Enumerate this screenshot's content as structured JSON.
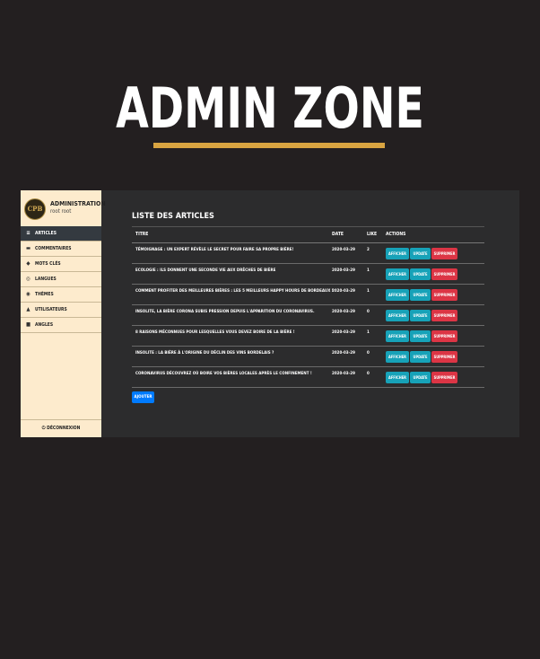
{
  "page": {
    "title": "ADMIN ZONE"
  },
  "brand": {
    "logo_text": "CPB",
    "title": "ADMINISTRATION",
    "subtitle": "root root"
  },
  "menu": [
    {
      "label": "ARTICLES",
      "icon": "list-icon",
      "glyph": "≡",
      "active": true
    },
    {
      "label": "COMMENTAIRES",
      "icon": "comment-icon",
      "glyph": "▬",
      "active": false
    },
    {
      "label": "MOTS CLÉS",
      "icon": "tag-icon",
      "glyph": "◆",
      "active": false
    },
    {
      "label": "LANGUES",
      "icon": "globe-icon",
      "glyph": "◎",
      "active": false
    },
    {
      "label": "THÈMES",
      "icon": "theme-icon",
      "glyph": "◉",
      "active": false
    },
    {
      "label": "UTILISATEURS",
      "icon": "user-icon",
      "glyph": "▲",
      "active": false
    },
    {
      "label": "ANGLES",
      "icon": "folder-icon",
      "glyph": "■",
      "active": false
    }
  ],
  "logout": {
    "label": "DÉCONNEXION"
  },
  "content": {
    "list_title": "LISTE DES ARTICLES",
    "columns": {
      "title": "TITRE",
      "date": "DATE",
      "like": "LIKE",
      "actions": "ACTIONS"
    },
    "buttons": {
      "show": "AFFICHER",
      "update": "UPDATE",
      "delete": "SUPPRIMER"
    },
    "rows": [
      {
        "title": "TÉMOIGNAGE : UN EXPERT RÉVÈLE LE SECRET POUR FAIRE SA PROPRE BIÈRE!",
        "date": "2020-03-29",
        "like": "2"
      },
      {
        "title": "ECOLOGIE : ILS DONNENT UNE SECONDE VIE AUX DRÊCHES DE BIÈRE",
        "date": "2020-03-29",
        "like": "1"
      },
      {
        "title": "COMMENT PROFITER DES MEILLEURES BIÈRES : LES 5 MEILLEURS HAPPY HOURS DE BORDEAUX !",
        "date": "2020-03-29",
        "like": "1"
      },
      {
        "title": "INSOLITE, LA BIÈRE CORONA SUBIS PRESSION DEPUIS L'APPARITION DU CORONAVIRUS.",
        "date": "2020-03-29",
        "like": "0"
      },
      {
        "title": "8 RAISONS MÉCONNUES POUR LESQUELLES VOUS DEVEZ BOIRE DE LA BIÈRE !",
        "date": "2020-03-29",
        "like": "1"
      },
      {
        "title": "INSOLITE : LA BIÈRE À L'ORIGINE DU DÉCLIN DES VINS BORDELAIS ?",
        "date": "2020-03-29",
        "like": "0"
      },
      {
        "title": "CORONAVIRUS DÉCOUVREZ OÙ BOIRE VOS BIÈRES LOCALES APRÈS LE CONFINEMENT !",
        "date": "2020-03-29",
        "like": "0"
      }
    ],
    "add_button": "AJOUTER"
  },
  "colors": {
    "background": "#231f20",
    "accent": "#d9a441",
    "sidebar": "#fdebcd",
    "panel": "#2c2c2d",
    "info": "#17a2b8",
    "danger": "#dc3545",
    "primary": "#007bff"
  }
}
